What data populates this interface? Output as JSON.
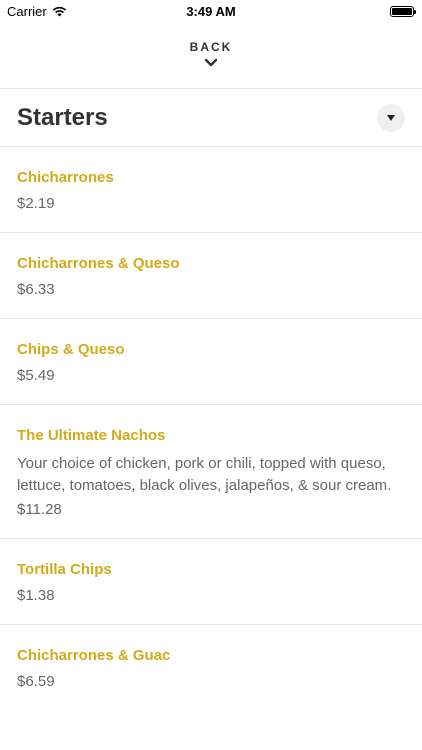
{
  "status_bar": {
    "carrier": "Carrier",
    "time": "3:49 AM"
  },
  "nav": {
    "back_label": "BACK"
  },
  "section": {
    "title": "Starters"
  },
  "items": [
    {
      "name": "Chicharrones",
      "description": "",
      "price": "$2.19"
    },
    {
      "name": "Chicharrones & Queso",
      "description": "",
      "price": "$6.33"
    },
    {
      "name": "Chips & Queso",
      "description": "",
      "price": "$5.49"
    },
    {
      "name": "The Ultimate Nachos",
      "description": "Your choice of chicken, pork or chili, topped with queso, lettuce, tomatoes, black olives, jalapeños, & sour cream.",
      "price": "$11.28"
    },
    {
      "name": "Tortilla Chips",
      "description": "",
      "price": "$1.38"
    },
    {
      "name": "Chicharrones & Guac",
      "description": "",
      "price": "$6.59"
    }
  ],
  "colors": {
    "accent": "#d4aa17",
    "text": "#333333",
    "muted": "#666666"
  }
}
